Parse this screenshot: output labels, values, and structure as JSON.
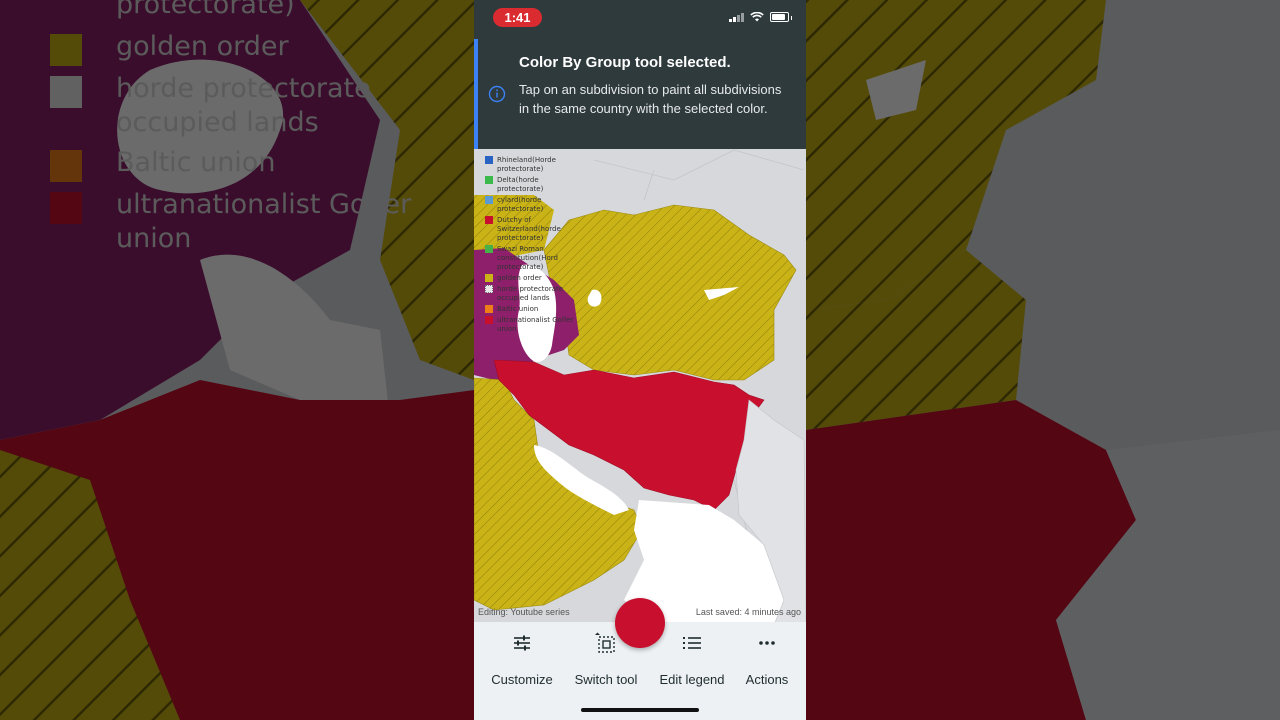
{
  "status": {
    "time": "1:41"
  },
  "toast": {
    "title": "Color By Group tool selected.",
    "body": "Tap on an subdivision to paint all subdivisions in the same country with the selected color.",
    "icon": "info-icon"
  },
  "legend": {
    "items": [
      {
        "label": "Rhineland(Horde protectorate)",
        "color": "#2b63c4"
      },
      {
        "label": "Delta(horde protectorate)",
        "color": "#3db84a"
      },
      {
        "label": "cylard(horde protectorate)",
        "color": "#5a9bd5"
      },
      {
        "label": "Dutchy of Switzerland(horde protectorate)",
        "color": "#c8102e"
      },
      {
        "label": "Swazi Roman constitution(Hord protectorate)",
        "color": "#46b04a"
      },
      {
        "label": "golden order",
        "color": "#c9b316"
      },
      {
        "label": "horde protectorate occupied lands",
        "color": "#e8e8e8"
      },
      {
        "label": "Baltic union",
        "color": "#ee7d1a"
      },
      {
        "label": "ultranationalist Golfer union",
        "color": "#c8102e"
      }
    ]
  },
  "background_legend": [
    {
      "label": "protectorate)",
      "color": ""
    },
    {
      "label": "golden order",
      "color": "#c9b316"
    },
    {
      "label": "horde protectorate occupied lands",
      "color": "#e8e8e8"
    },
    {
      "label": "Baltic union",
      "color": "#ee7d1a"
    },
    {
      "label": "ultranationalist Golfer union",
      "color": "#c8102e"
    }
  ],
  "map": {
    "editing": "Editing: Youtube series",
    "last_saved": "Last saved: 4 minutes ago",
    "colors": {
      "gold": "#c9b316",
      "purple": "#8d1f6b",
      "red": "#c8102e",
      "land": "#d6d8db",
      "water": "#ffffff"
    }
  },
  "toolbar": {
    "customize": "Customize",
    "switch_tool": "Switch tool",
    "edit_legend": "Edit legend",
    "actions": "Actions"
  }
}
